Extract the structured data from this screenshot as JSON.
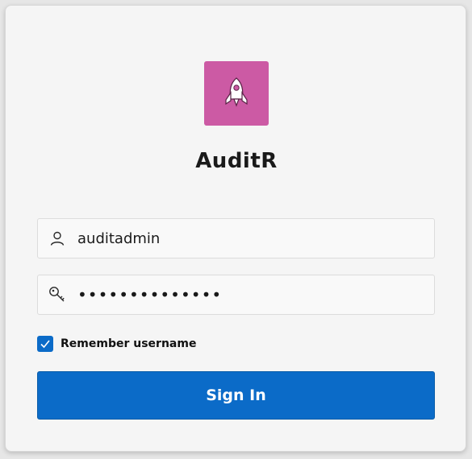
{
  "app": {
    "title": "AuditR",
    "icon": "rocket-icon",
    "icon_bg": "#cc5aa4"
  },
  "username": {
    "icon": "user-icon",
    "value": "auditadmin"
  },
  "password": {
    "icon": "key-icon",
    "value": "••••••••••••••"
  },
  "remember": {
    "label": "Remember username",
    "checked": true,
    "accent": "#0b6bc8"
  },
  "signin": {
    "label": "Sign In",
    "bg": "#0b6bc8"
  }
}
